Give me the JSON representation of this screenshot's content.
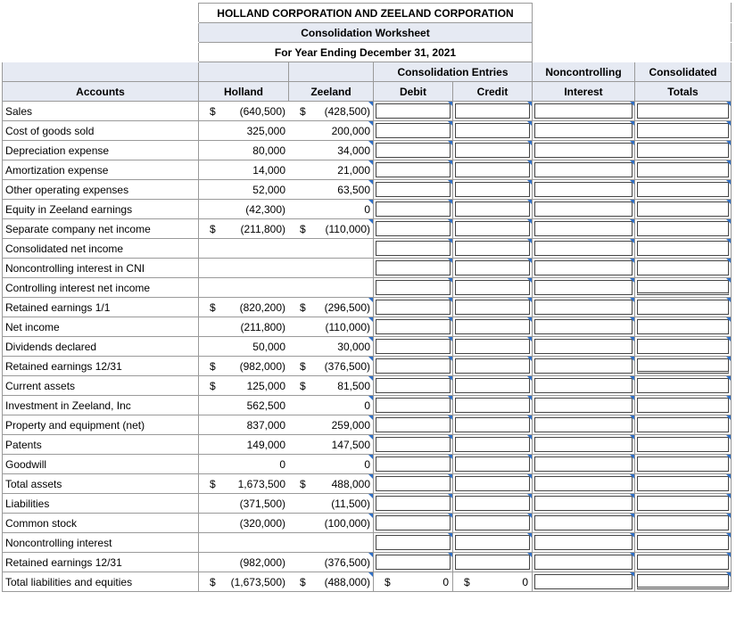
{
  "title_lines": [
    "HOLLAND CORPORATION AND ZEELAND CORPORATION",
    "Consolidation Worksheet",
    "For Year Ending December 31, 2021"
  ],
  "headers": {
    "consolidation_entries": "Consolidation Entries",
    "noncontrolling_top": "Noncontrolling",
    "consolidated_top": "Consolidated",
    "accounts": "Accounts",
    "holland": "Holland",
    "zeeland": "Zeeland",
    "debit": "Debit",
    "credit": "Credit",
    "noncontrolling_bottom": "Interest",
    "consolidated_bottom": "Totals"
  },
  "rows": [
    {
      "account": "Sales",
      "h_dollar": "$",
      "holland": "(640,500)",
      "z_dollar": "$",
      "zeeland": "(428,500)"
    },
    {
      "account": "Cost of goods sold",
      "h_dollar": "",
      "holland": "325,000",
      "z_dollar": "",
      "zeeland": "200,000"
    },
    {
      "account": "Depreciation expense",
      "h_dollar": "",
      "holland": "80,000",
      "z_dollar": "",
      "zeeland": "34,000"
    },
    {
      "account": "Amortization expense",
      "h_dollar": "",
      "holland": "14,000",
      "z_dollar": "",
      "zeeland": "21,000"
    },
    {
      "account": "Other operating expenses",
      "h_dollar": "",
      "holland": "52,000",
      "z_dollar": "",
      "zeeland": "63,500"
    },
    {
      "account": "Equity in Zeeland earnings",
      "h_dollar": "",
      "holland": "(42,300)",
      "z_dollar": "",
      "zeeland": "0"
    },
    {
      "account": "Separate company net income",
      "h_dollar": "$",
      "holland": "(211,800)",
      "z_dollar": "$",
      "zeeland": "(110,000)"
    },
    {
      "account": "Consolidated net income",
      "h_dollar": "",
      "holland": "",
      "z_dollar": "",
      "zeeland": ""
    },
    {
      "account": "Noncontrolling interest in CNI",
      "h_dollar": "",
      "holland": "",
      "z_dollar": "",
      "zeeland": ""
    },
    {
      "account": "Controlling interest net income",
      "h_dollar": "",
      "holland": "",
      "z_dollar": "",
      "zeeland": ""
    },
    {
      "account": "Retained earnings 1/1",
      "h_dollar": "$",
      "holland": "(820,200)",
      "z_dollar": "$",
      "zeeland": "(296,500)"
    },
    {
      "account": "Net income",
      "h_dollar": "",
      "holland": "(211,800)",
      "z_dollar": "",
      "zeeland": "(110,000)"
    },
    {
      "account": "Dividends declared",
      "h_dollar": "",
      "holland": "50,000",
      "z_dollar": "",
      "zeeland": "30,000"
    },
    {
      "account": "Retained earnings 12/31",
      "h_dollar": "$",
      "holland": "(982,000)",
      "z_dollar": "$",
      "zeeland": "(376,500)"
    },
    {
      "account": "Current assets",
      "h_dollar": "$",
      "holland": "125,000",
      "z_dollar": "$",
      "zeeland": "81,500"
    },
    {
      "account": "Investment in Zeeland, Inc",
      "h_dollar": "",
      "holland": "562,500",
      "z_dollar": "",
      "zeeland": "0"
    },
    {
      "account": "Property and equipment (net)",
      "h_dollar": "",
      "holland": "837,000",
      "z_dollar": "",
      "zeeland": "259,000"
    },
    {
      "account": "Patents",
      "h_dollar": "",
      "holland": "149,000",
      "z_dollar": "",
      "zeeland": "147,500"
    },
    {
      "account": "Goodwill",
      "h_dollar": "",
      "holland": "0",
      "z_dollar": "",
      "zeeland": "0"
    },
    {
      "account": "Total assets",
      "h_dollar": "$",
      "holland": "1,673,500",
      "z_dollar": "$",
      "zeeland": "488,000"
    },
    {
      "account": "Liabilities",
      "h_dollar": "",
      "holland": "(371,500)",
      "z_dollar": "",
      "zeeland": "(11,500)"
    },
    {
      "account": "Common stock",
      "h_dollar": "",
      "holland": "(320,000)",
      "z_dollar": "",
      "zeeland": "(100,000)"
    },
    {
      "account": "Noncontrolling interest",
      "h_dollar": "",
      "holland": "",
      "z_dollar": "",
      "zeeland": ""
    },
    {
      "account": "Retained earnings 12/31",
      "h_dollar": "",
      "holland": "(982,000)",
      "z_dollar": "",
      "zeeland": "(376,500)"
    },
    {
      "account": "Total liabilities and equities",
      "h_dollar": "$",
      "holland": "(1,673,500)",
      "z_dollar": "$",
      "zeeland": "(488,000)"
    }
  ],
  "last_row_totals": {
    "debit_dollar": "$",
    "debit_value": "0",
    "credit_dollar": "$",
    "credit_value": "0"
  },
  "colors": {
    "header_bg": "#e6eaf3",
    "cell_marker": "#2f6fc6"
  }
}
